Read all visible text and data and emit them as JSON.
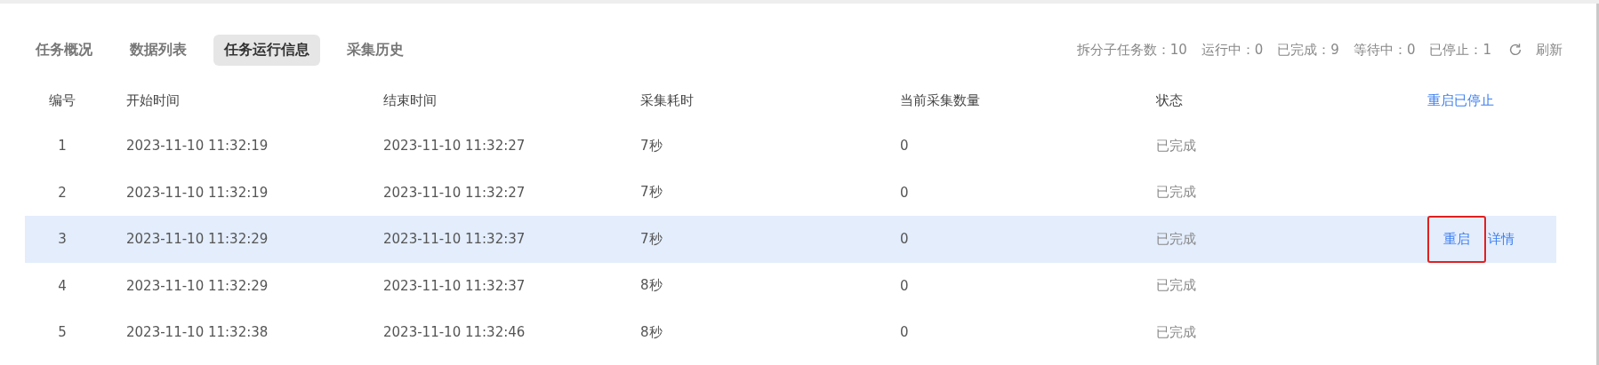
{
  "tabs": [
    {
      "label": "任务概况",
      "selected": false
    },
    {
      "label": "数据列表",
      "selected": false
    },
    {
      "label": "任务运行信息",
      "selected": true
    },
    {
      "label": "采集历史",
      "selected": false
    }
  ],
  "stats": [
    {
      "label": "拆分子任务数：",
      "value": "10"
    },
    {
      "label": "运行中：",
      "value": "0"
    },
    {
      "label": "已完成：",
      "value": "9"
    },
    {
      "label": "等待中：",
      "value": "0"
    },
    {
      "label": "已停止：",
      "value": "1"
    }
  ],
  "refresh_button": "刷新",
  "table": {
    "columns": [
      "编号",
      "开始时间",
      "结束时间",
      "采集耗时",
      "当前采集数量",
      "状态"
    ],
    "header_action": "重启已停止",
    "rows": [
      {
        "cells": [
          "1",
          "2023-11-10 11:32:19",
          "2023-11-10 11:32:27",
          "7秒",
          "0",
          "已完成"
        ],
        "selected": false,
        "actions": []
      },
      {
        "cells": [
          "2",
          "2023-11-10 11:32:19",
          "2023-11-10 11:32:27",
          "7秒",
          "0",
          "已完成"
        ],
        "selected": false,
        "actions": []
      },
      {
        "cells": [
          "3",
          "2023-11-10 11:32:29",
          "2023-11-10 11:32:37",
          "7秒",
          "0",
          "已完成"
        ],
        "selected": true,
        "actions": [
          {
            "label": "重启",
            "highlighted": true
          },
          {
            "label": "详情",
            "highlighted": false
          }
        ]
      },
      {
        "cells": [
          "4",
          "2023-11-10 11:32:29",
          "2023-11-10 11:32:37",
          "8秒",
          "0",
          "已完成"
        ],
        "selected": false,
        "actions": []
      },
      {
        "cells": [
          "5",
          "2023-11-10 11:32:38",
          "2023-11-10 11:32:46",
          "8秒",
          "0",
          "已完成"
        ],
        "selected": false,
        "actions": []
      }
    ]
  }
}
